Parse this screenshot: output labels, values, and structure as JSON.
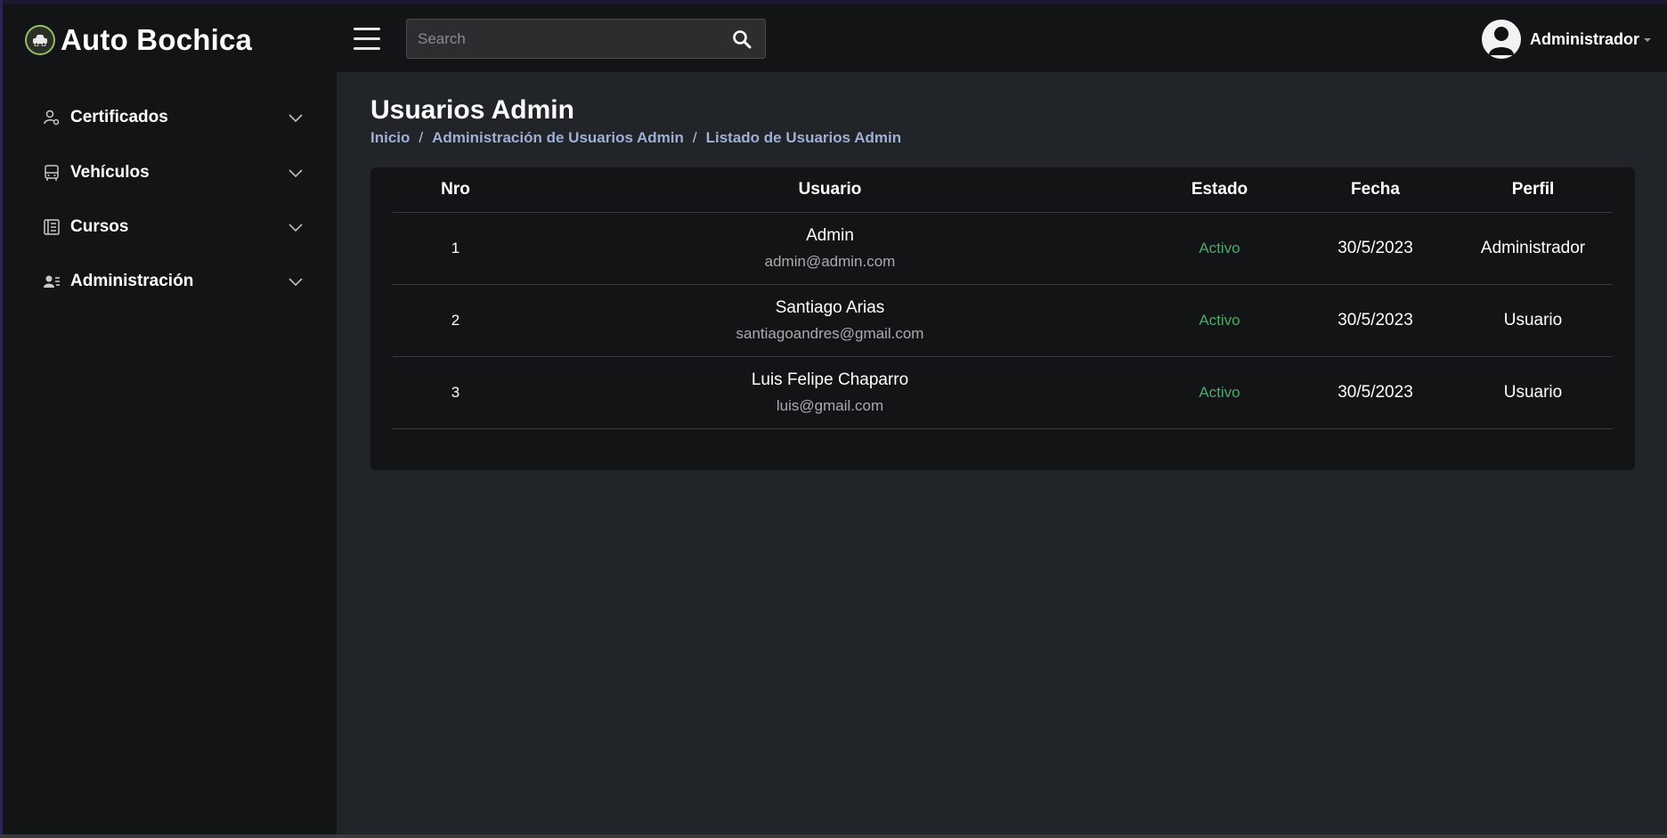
{
  "brand": {
    "name": "Auto Bochica"
  },
  "header": {
    "search_placeholder": "Search",
    "user_name": "Administrador"
  },
  "sidebar": {
    "items": [
      {
        "label": "Certificados",
        "icon": "user-cog-icon"
      },
      {
        "label": "Vehículos",
        "icon": "bus-icon"
      },
      {
        "label": "Cursos",
        "icon": "newspaper-icon"
      },
      {
        "label": "Administración",
        "icon": "users-list-icon"
      }
    ]
  },
  "page": {
    "title": "Usuarios Admin",
    "breadcrumb": [
      "Inicio",
      "Administración de Usuarios Admin",
      "Listado de Usuarios Admin"
    ]
  },
  "table": {
    "columns": [
      "Nro",
      "Usuario",
      "Estado",
      "Fecha",
      "Perfil"
    ],
    "rows": [
      {
        "nro": "1",
        "name": "Admin",
        "email": "admin@admin.com",
        "estado": "Activo",
        "fecha": "30/5/2023",
        "perfil": "Administrador"
      },
      {
        "nro": "2",
        "name": "Santiago Arias",
        "email": "santiagoandres@gmail.com",
        "estado": "Activo",
        "fecha": "30/5/2023",
        "perfil": "Usuario"
      },
      {
        "nro": "3",
        "name": "Luis Felipe Chaparro",
        "email": "luis@gmail.com",
        "estado": "Activo",
        "fecha": "30/5/2023",
        "perfil": "Usuario"
      }
    ]
  },
  "colors": {
    "status_active": "#4aa96c",
    "breadcrumb_link": "#9fb0d4",
    "main_bg": "#212429",
    "panel_bg": "#131415"
  }
}
